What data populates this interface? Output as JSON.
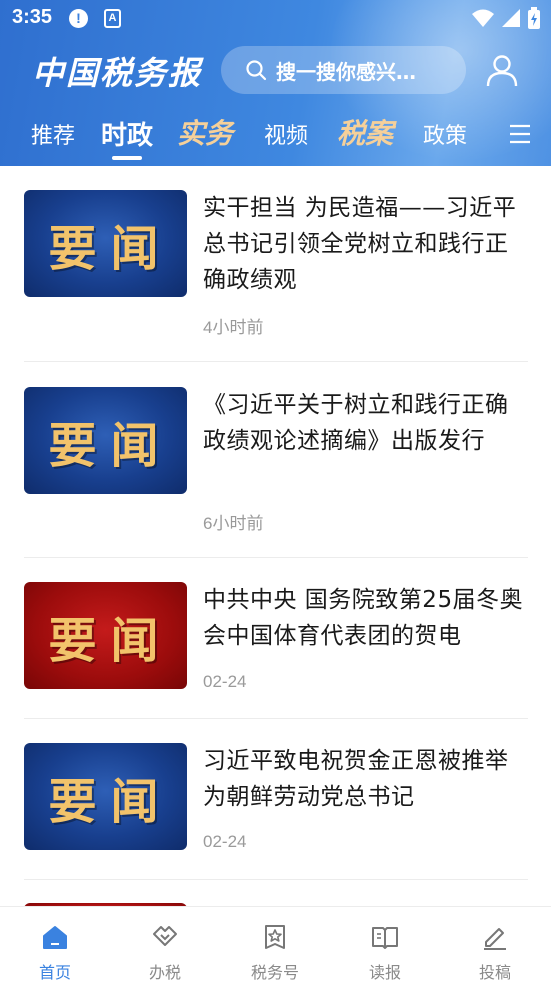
{
  "status_bar": {
    "time": "3:35"
  },
  "header": {
    "logo": "中国税务报",
    "search_placeholder": "搜一搜你感兴…"
  },
  "tabs": [
    {
      "label": "推荐"
    },
    {
      "label": "时政",
      "active": true
    },
    {
      "label": "实务"
    },
    {
      "label": "视频"
    },
    {
      "label": "税案"
    },
    {
      "label": "政策"
    }
  ],
  "news": [
    {
      "title": "实干担当 为民造福——习近平总书记引领全党树立和践行正确政绩观",
      "time": "4小时前",
      "thumb_text": "要闻",
      "thumb_color": "blue"
    },
    {
      "title": "《习近平关于树立和践行正确政绩观论述摘编》出版发行",
      "time": "6小时前",
      "thumb_text": "要闻",
      "thumb_color": "blue"
    },
    {
      "title": "中共中央 国务院致第25届冬奥会中国体育代表团的贺电",
      "time": "02-24",
      "thumb_text": "要闻",
      "thumb_color": "red"
    },
    {
      "title": "习近平致电祝贺金正恩被推举为朝鲜劳动党总书记",
      "time": "02-24",
      "thumb_text": "要闻",
      "thumb_color": "blue"
    }
  ],
  "bottom_nav": [
    {
      "label": "首页",
      "icon": "home-icon",
      "active": true
    },
    {
      "label": "办税",
      "icon": "tax-service-icon"
    },
    {
      "label": "税务号",
      "icon": "star-badge-icon"
    },
    {
      "label": "读报",
      "icon": "book-icon"
    },
    {
      "label": "投稿",
      "icon": "pen-icon"
    }
  ],
  "colors": {
    "header_blue": "#3a80dc",
    "accent": "#3a82e0",
    "special_tab": "#f5d09a",
    "thumb_text": "#f2c36b"
  }
}
